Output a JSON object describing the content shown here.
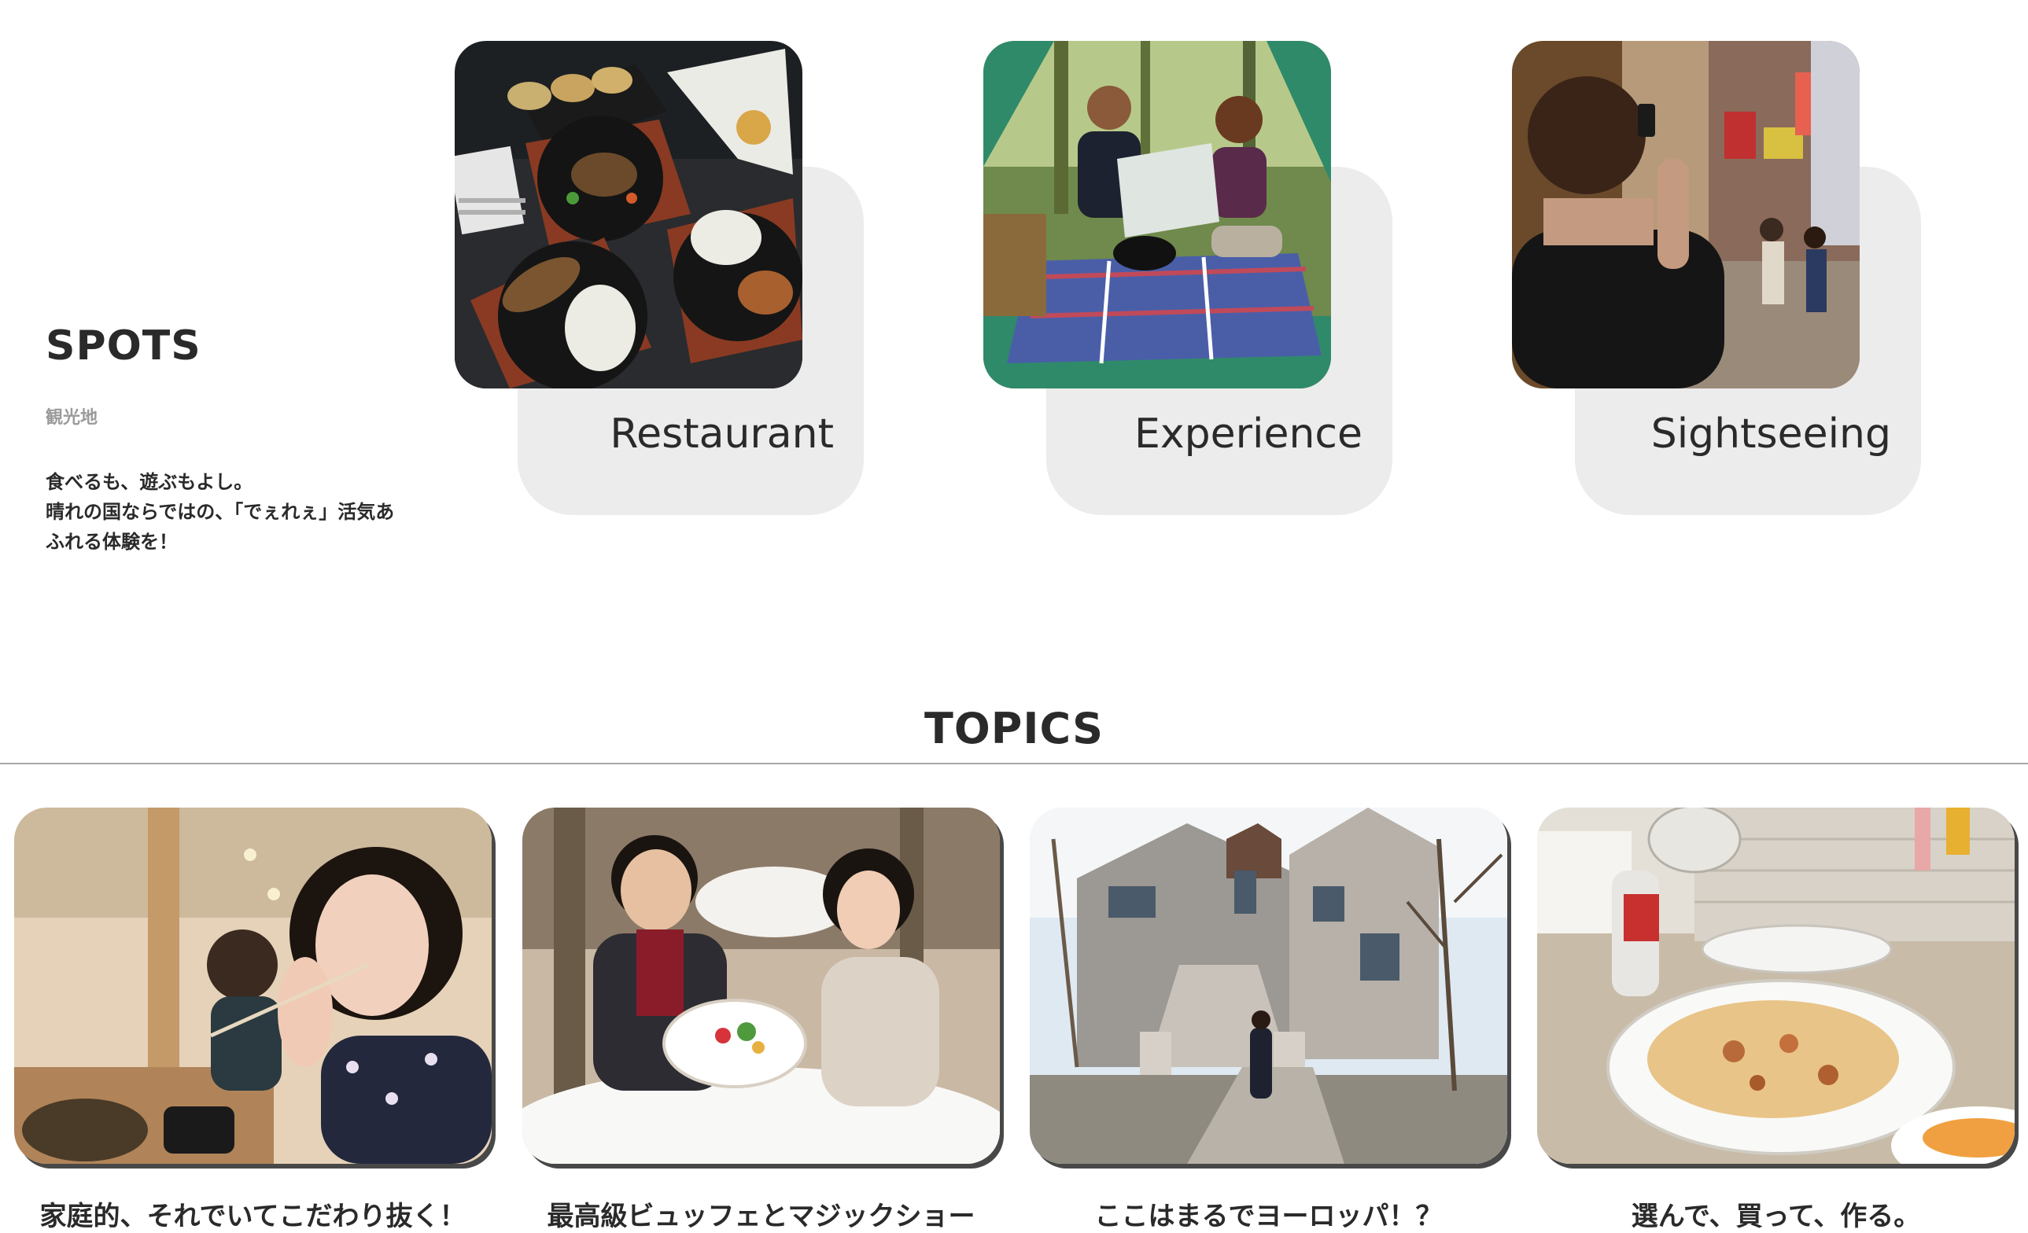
{
  "spots": {
    "title": "SPOTS",
    "subtitle": "観光地",
    "description_lines": [
      "食べるも、遊ぶもよし。",
      "晴れの国ならではの、「でぇれぇ」活気あ",
      "ふれる体験を！"
    ],
    "cards": [
      {
        "label": "Restaurant",
        "image": "food-dishes-photo"
      },
      {
        "label": "Experience",
        "image": "camping-couple-photo"
      },
      {
        "label": "Sightseeing",
        "image": "street-photography-photo"
      }
    ]
  },
  "topics": {
    "title": "TOPICS",
    "cards": [
      {
        "title": "家庭的、それでいてこだわり抜く！",
        "image": "woman-at-restaurant-photo"
      },
      {
        "title": "最高級ビュッフェとマジックショー",
        "image": "couple-with-dessert-plate-photo"
      },
      {
        "title": "ここはまるでヨーロッパ！？",
        "image": "european-castle-photo"
      },
      {
        "title": "選んで、買って、作る。",
        "image": "pizza-on-table-photo"
      }
    ]
  },
  "colors": {
    "text": "#2a2a2a",
    "muted": "#9a9a9a",
    "card_bg": "#ececec",
    "divider": "#a8a8a8"
  }
}
